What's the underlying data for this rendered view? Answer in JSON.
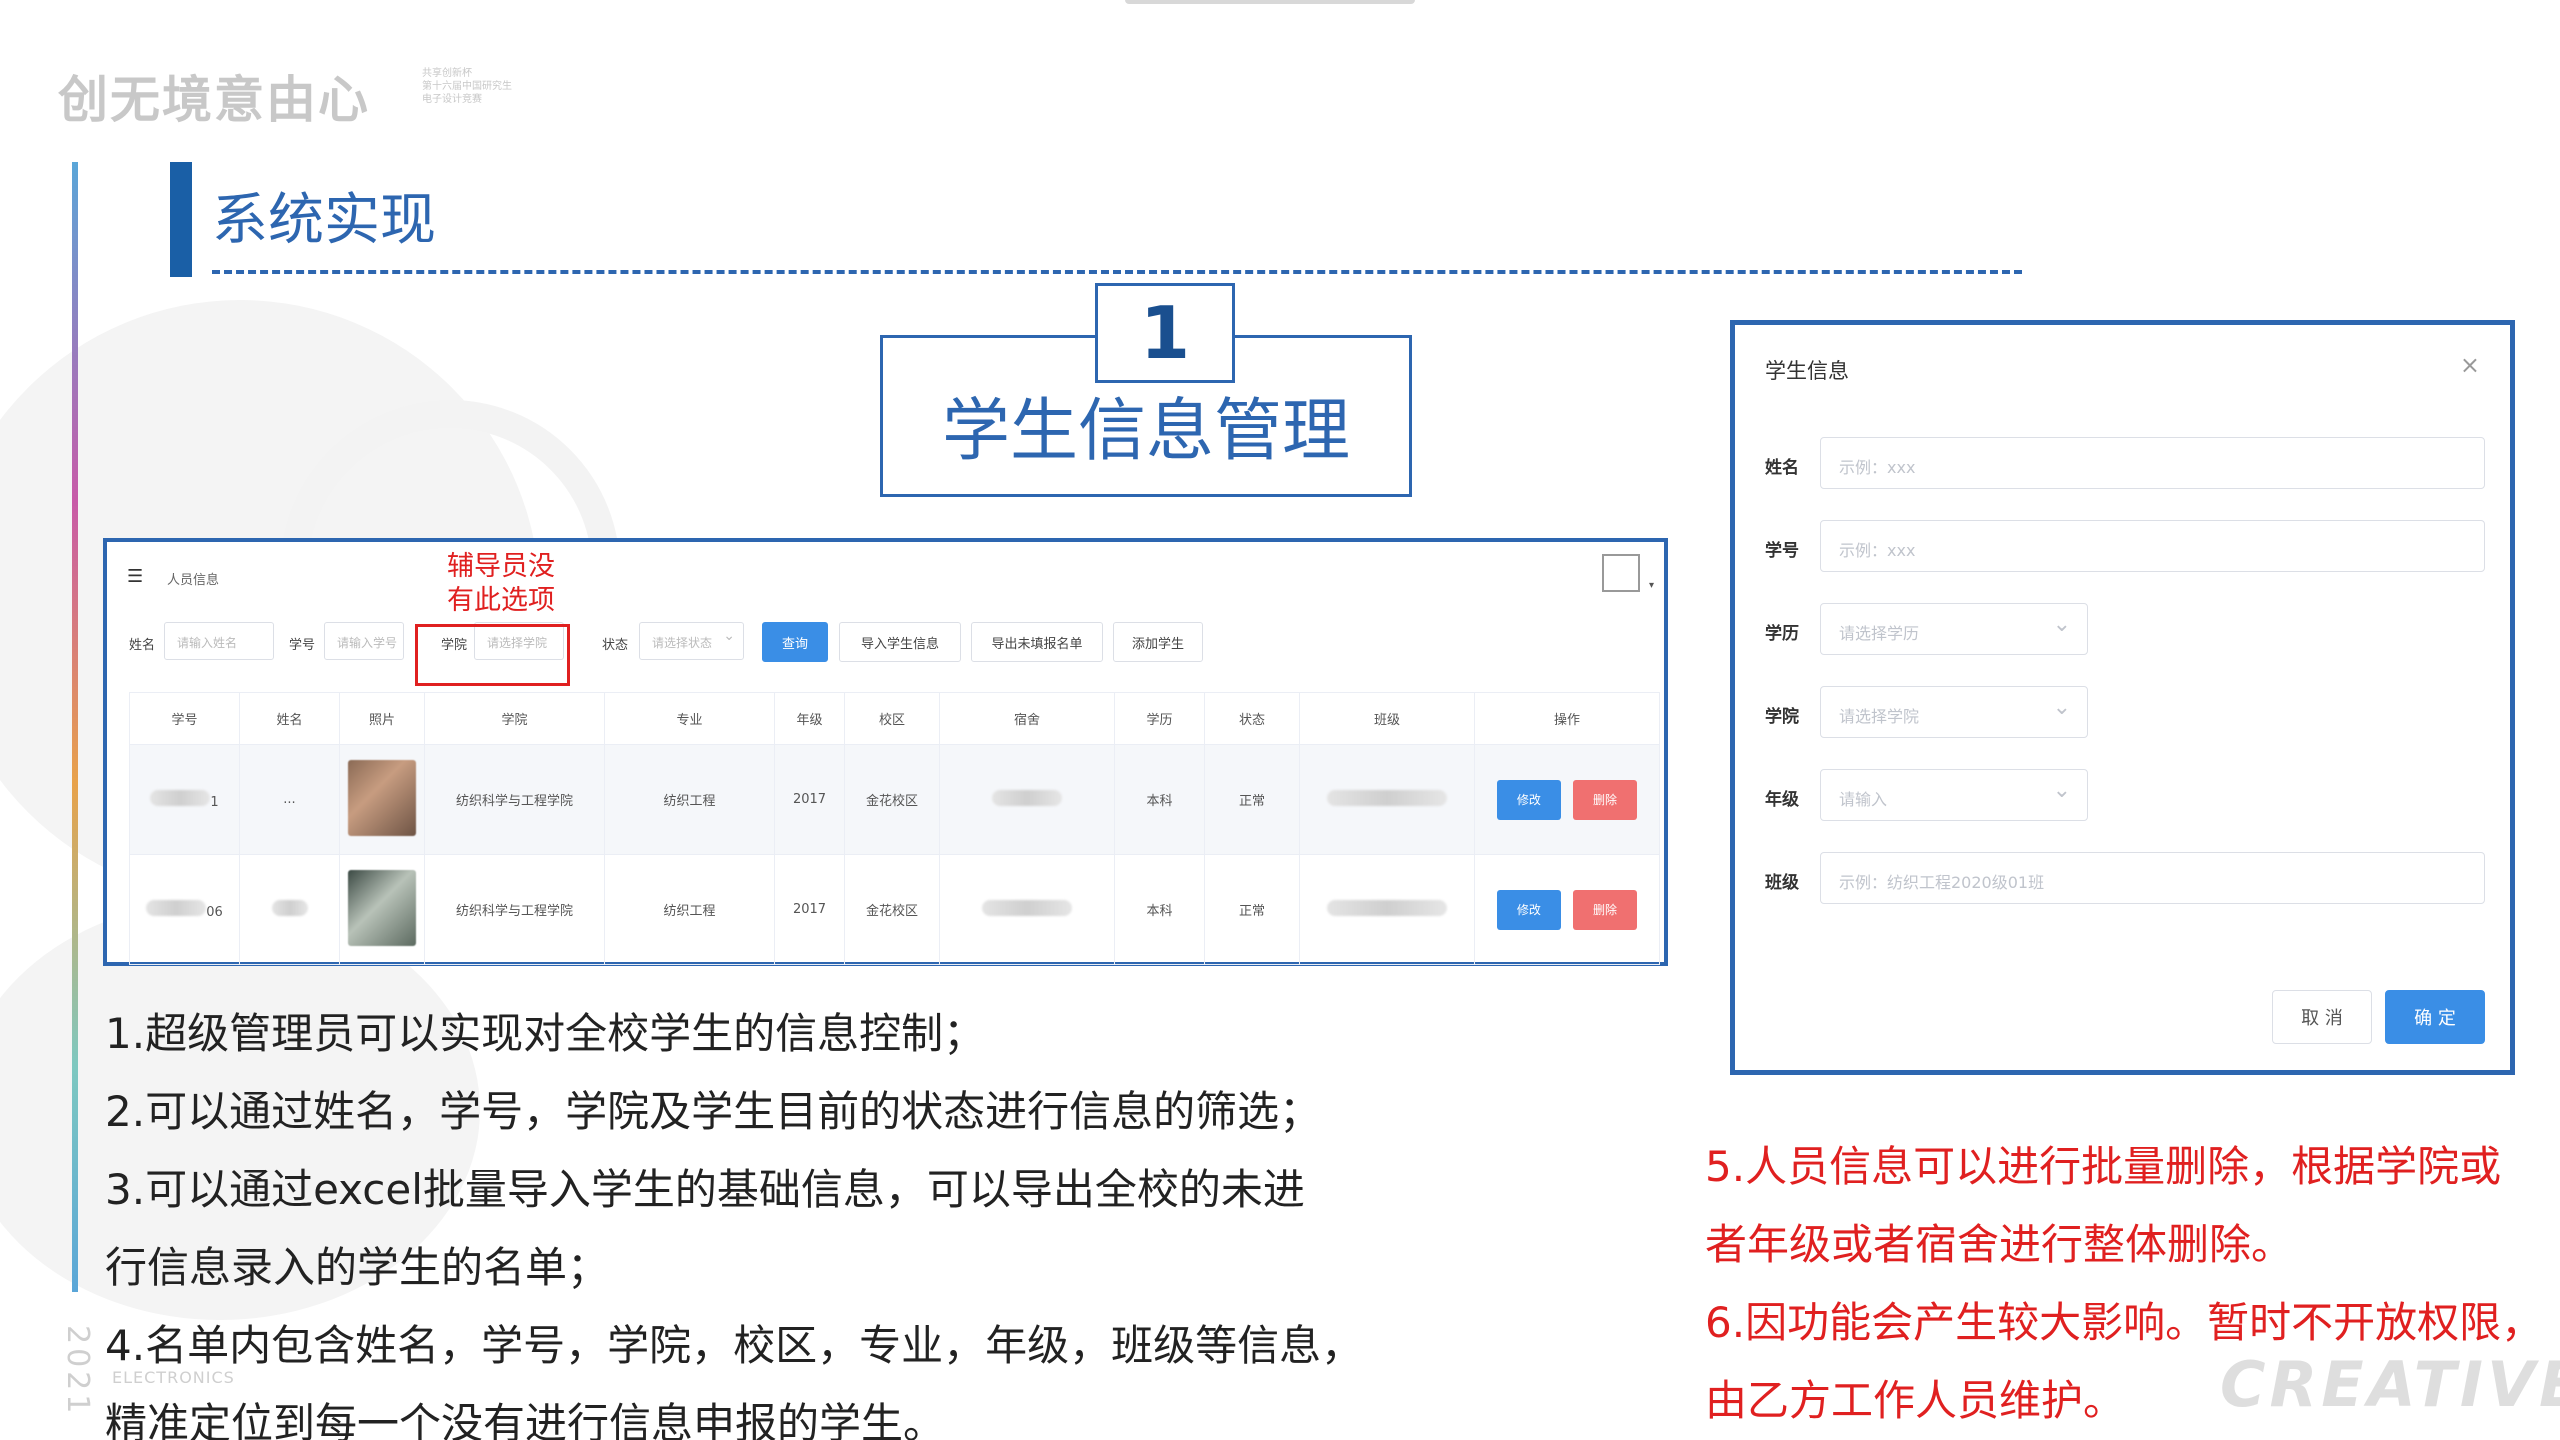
{
  "logo": {
    "text": "创无境意由心",
    "sub_lines": [
      "共享创新杯",
      "第十六届中国研究生",
      "电子设计竞赛"
    ]
  },
  "section": {
    "title": "系统实现"
  },
  "feature": {
    "number": "1",
    "title": "学生信息管理"
  },
  "screenshot": {
    "page_title": "人员信息",
    "note_lines": [
      "辅导员没",
      "有此选项"
    ],
    "filters": {
      "name_label": "姓名",
      "name_placeholder": "请输入姓名",
      "id_label": "学号",
      "id_placeholder": "请输入学号",
      "college_label": "学院",
      "college_placeholder": "请选择学院",
      "status_label": "状态",
      "status_placeholder": "请选择状态",
      "query_btn": "查询",
      "import_btn": "导入学生信息",
      "export_btn": "导出未填报名单",
      "add_btn": "添加学生"
    },
    "table": {
      "columns": [
        "学号",
        "姓名",
        "照片",
        "学院",
        "专业",
        "年级",
        "校区",
        "宿舍",
        "学历",
        "状态",
        "班级",
        "操作"
      ],
      "rows": [
        {
          "id_suffix": "1",
          "name": "...",
          "college": "纺织科学与工程学院",
          "major": "纺织工程",
          "grade": "2017",
          "campus": "金花校区",
          "degree": "本科",
          "status": "正常"
        },
        {
          "id_suffix": "06",
          "name": "",
          "college": "纺织科学与工程学院",
          "major": "纺织工程",
          "grade": "2017",
          "campus": "金花校区",
          "degree": "本科",
          "status": "正常"
        }
      ],
      "edit_label": "修改",
      "delete_label": "删除"
    }
  },
  "dialog": {
    "title": "学生信息",
    "close": "×",
    "fields": {
      "name": {
        "label": "姓名",
        "placeholder": "示例：xxx"
      },
      "id": {
        "label": "学号",
        "placeholder": "示例：xxx"
      },
      "degree": {
        "label": "学历",
        "placeholder": "请选择学历"
      },
      "college": {
        "label": "学院",
        "placeholder": "请选择学院"
      },
      "grade": {
        "label": "年级",
        "placeholder": "请输入"
      },
      "class": {
        "label": "班级",
        "placeholder": "示例：纺织工程2020级01班"
      }
    },
    "cancel": "取 消",
    "ok": "确 定"
  },
  "bullets": [
    "1.超级管理员可以实现对全校学生的信息控制；",
    "2.可以通过姓名，学号，学院及学生目前的状态进行信息的筛选；",
    "3.可以通过excel批量导入学生的基础信息，可以导出全校的未进",
    "行信息录入的学生的名单；",
    "4.名单内包含姓名，学号，学院，校区，专业，年级，班级等信息，",
    "精准定位到每一个没有进行信息申报的学生。"
  ],
  "red_bullets": [
    "5.人员信息可以进行批量删除，根据学院或",
    "者年级或者宿舍进行整体删除。",
    "6.因功能会产生较大影响。暂时不开放权限，",
    "由乙方工作人员维护。"
  ],
  "footer": {
    "year": "2021",
    "electronics": "ELECTRONICS",
    "creative": "CREATIVE"
  },
  "colors": {
    "accent": "#2d66b0",
    "alert": "#e02020",
    "primary_btn": "#3a8ee6",
    "danger_btn": "#f07070"
  }
}
